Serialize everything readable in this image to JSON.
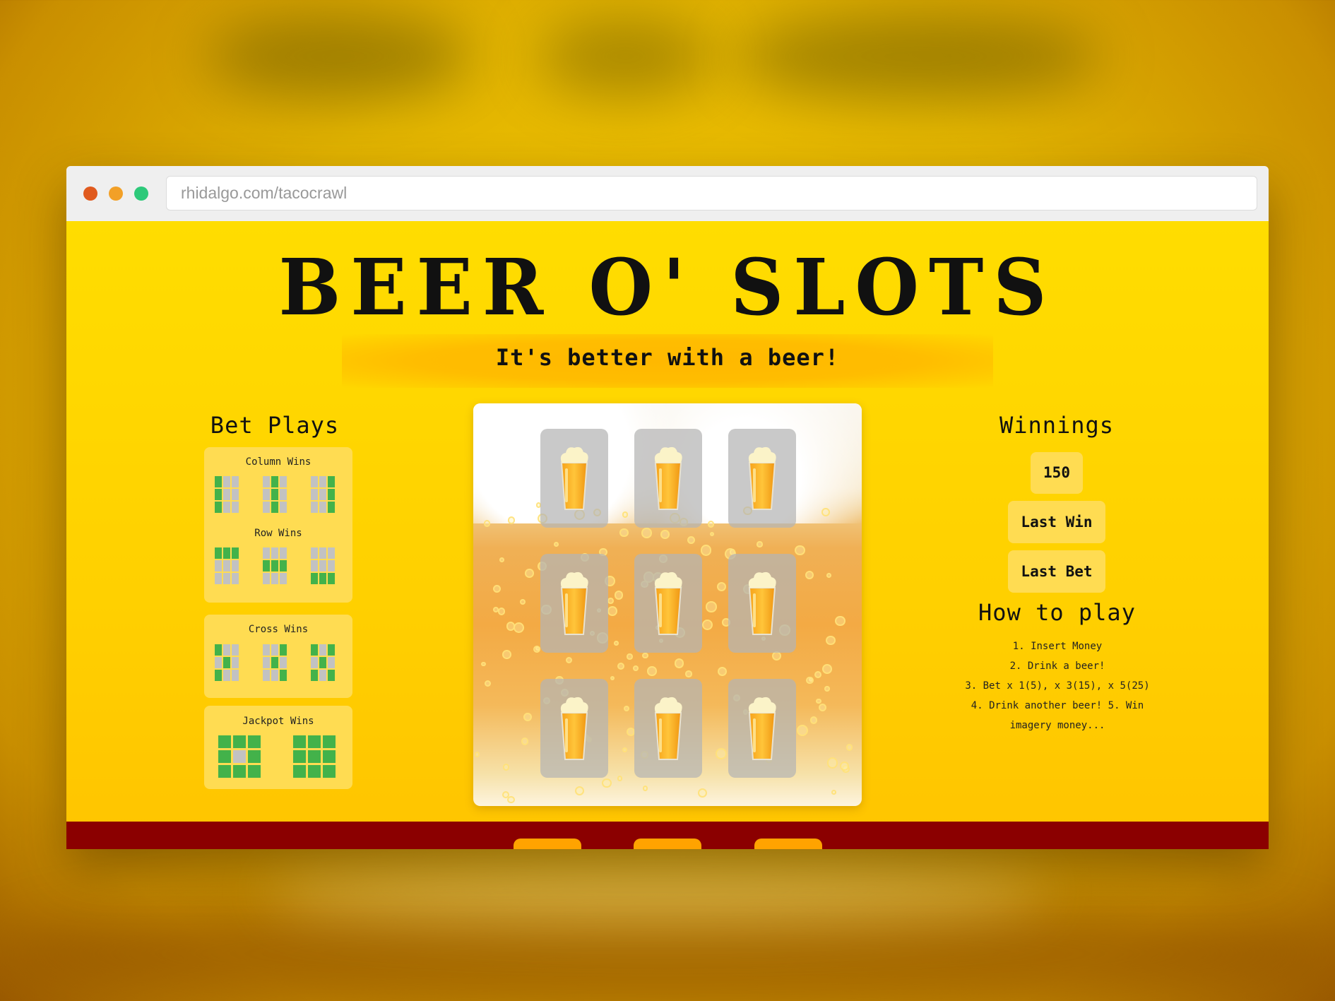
{
  "browser": {
    "url": "rhidalgo.com/tacocrawl"
  },
  "header": {
    "title": "BEER O' SLOTS",
    "tagline": "It's better with a beer!"
  },
  "bet_plays": {
    "title": "Bet Plays",
    "column_wins_label": "Column Wins",
    "row_wins_label": "Row Wins",
    "cross_wins_label": "Cross Wins",
    "jackpot_wins_label": "Jackpot Wins"
  },
  "reels": {
    "symbols": [
      "beer",
      "beer",
      "beer",
      "beer",
      "beer",
      "beer",
      "beer",
      "beer",
      "beer"
    ]
  },
  "winnings": {
    "title": "Winnings",
    "amount": "150",
    "last_win_label": "Last Win",
    "last_bet_label": "Last Bet"
  },
  "how_to_play": {
    "title": "How to play",
    "steps": [
      "1. Insert Money",
      "2. Drink a beer!",
      "3. Bet x 1(5), x 3(15), x 5(25)",
      "4. Drink another beer! 5. Win",
      "imagery money..."
    ]
  },
  "colors": {
    "page_bg": "#ffd800",
    "panel_bg": "#ffdc52",
    "win_cell": "#43b24a",
    "empty_cell": "#c2c2c2",
    "footer_bg": "#8b0000",
    "footer_button": "#ffa300"
  }
}
